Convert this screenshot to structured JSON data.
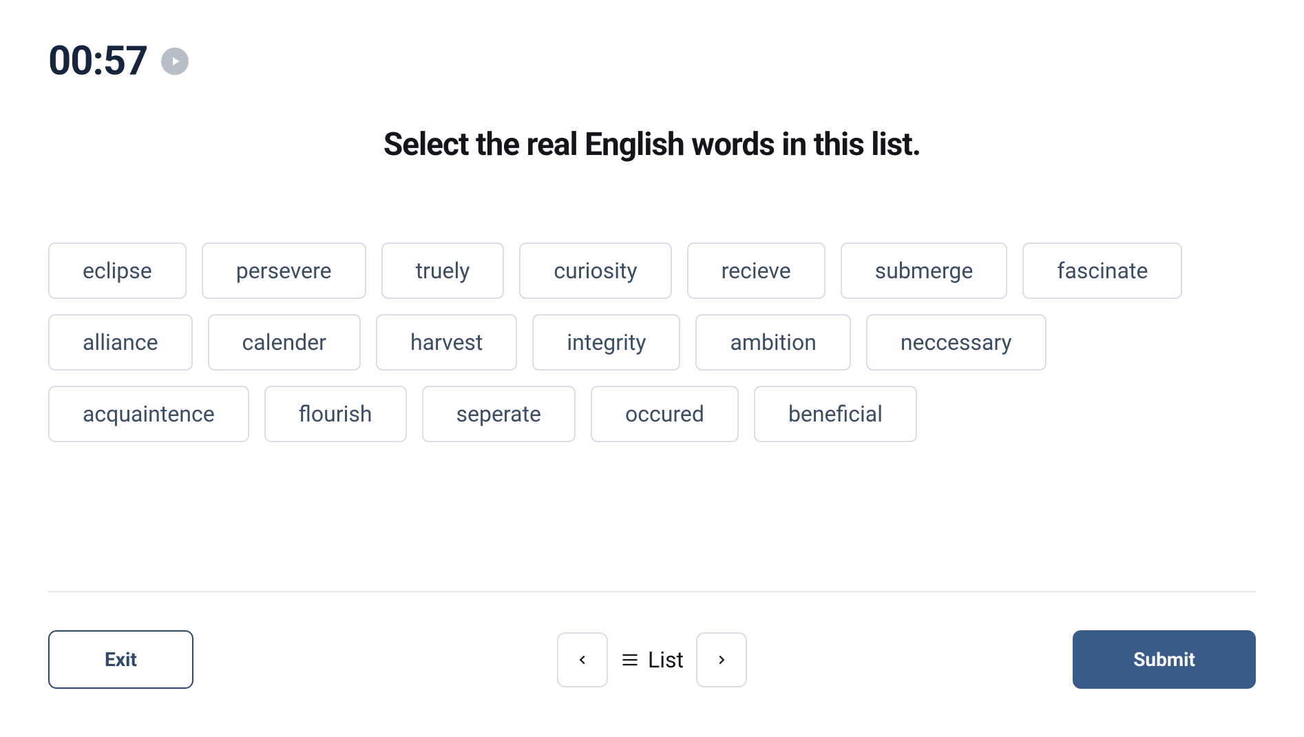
{
  "timer": "00:57",
  "question": "Select the real English words in this list.",
  "words": [
    "eclipse",
    "persevere",
    "truely",
    "curiosity",
    "recieve",
    "submerge",
    "fascinate",
    "alliance",
    "calender",
    "harvest",
    "integrity",
    "ambition",
    "neccessary",
    "acquaintence",
    "flourish",
    "seperate",
    "occured",
    "beneficial"
  ],
  "footer": {
    "exit_label": "Exit",
    "list_label": "List",
    "submit_label": "Submit"
  }
}
